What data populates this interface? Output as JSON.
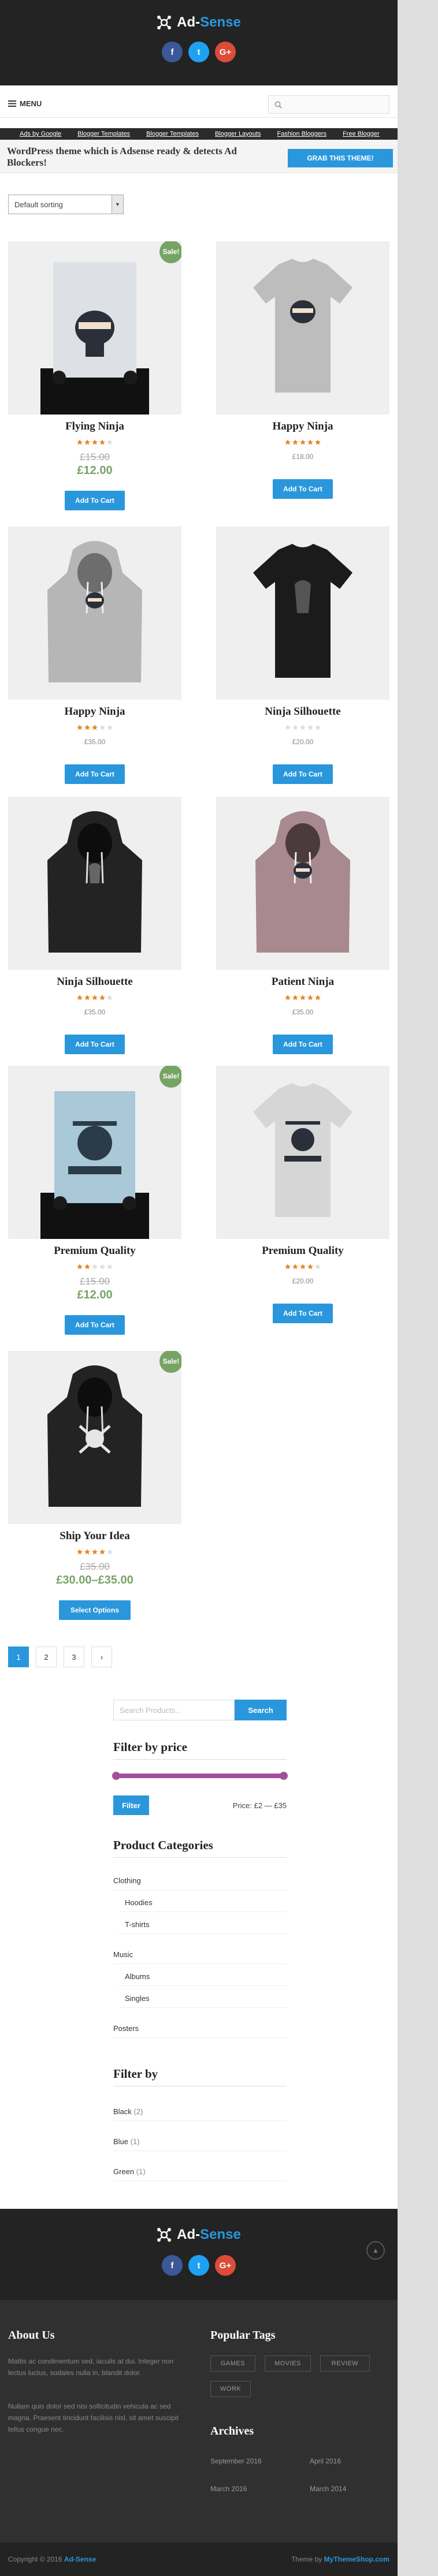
{
  "header": {
    "logo_part1": "Ad-",
    "logo_part2": "Sense",
    "social": [
      {
        "icon": "facebook-icon",
        "glyph": "f"
      },
      {
        "icon": "twitter-icon",
        "glyph": "t"
      },
      {
        "icon": "google-plus-icon",
        "glyph": "G+"
      }
    ]
  },
  "nav": {
    "menu_label": "MENU",
    "search_icon": "search-icon"
  },
  "ticker": [
    "Ads by Google",
    "Blogger Templates",
    "Blogger Templates",
    "Blogger Layouts",
    "Fashion Bloggers",
    "Free Blogger"
  ],
  "promo": {
    "text": "WordPress theme which is Adsense ready & detects Ad Blockers!",
    "button": "GRAB THIS THEME!"
  },
  "sorting": {
    "selected": "Default sorting"
  },
  "products": [
    {
      "title": "Flying Ninja",
      "sale": "Sale!",
      "rating": 4,
      "old_price": "£15.00",
      "price": "£12.00",
      "button": "Add To Cart",
      "image": "poster-ninja"
    },
    {
      "title": "Happy Ninja",
      "rating": 5,
      "price": "£18.00",
      "button": "Add To Cart",
      "image": "tshirt-grey"
    },
    {
      "title": "Happy Ninja",
      "rating": 3,
      "price": "£35.00",
      "button": "Add To Cart",
      "image": "hoodie-grey"
    },
    {
      "title": "Ninja Silhouette",
      "rating": 0,
      "price": "£20.00",
      "button": "Add To Cart",
      "image": "tshirt-black"
    },
    {
      "title": "Ninja Silhouette",
      "rating": 4,
      "price": "£35.00",
      "button": "Add To Cart",
      "image": "hoodie-black"
    },
    {
      "title": "Patient Ninja",
      "rating": 5,
      "price": "£35.00",
      "button": "Add To Cart",
      "image": "hoodie-mauve"
    },
    {
      "title": "Premium Quality",
      "sale": "Sale!",
      "rating": 2,
      "old_price": "£15.00",
      "price": "£12.00",
      "button": "Add To Cart",
      "image": "poster-woo"
    },
    {
      "title": "Premium Quality",
      "rating": 4,
      "price": "£20.00",
      "button": "Add To Cart",
      "image": "tshirt-woo"
    },
    {
      "title": "Ship Your Idea",
      "sale": "Sale!",
      "rating": 4,
      "old_price": "£35.00",
      "price": "£30.00–£35.00",
      "button": "Select Options",
      "image": "hoodie-ship"
    }
  ],
  "pagination": [
    "1",
    "2",
    "3",
    "›"
  ],
  "widgets": {
    "search": {
      "placeholder": "Search Products...",
      "button": "Search"
    },
    "price_filter": {
      "title": "Filter by price",
      "button": "Filter",
      "range": "Price: £2 — £35"
    },
    "categories": {
      "title": "Product Categories",
      "items": [
        {
          "label": "Clothing",
          "level": 0
        },
        {
          "label": "Hoodies",
          "level": 1
        },
        {
          "label": "T-shirts",
          "level": 1
        },
        {
          "label": "Music",
          "level": 0
        },
        {
          "label": "Albums",
          "level": 1
        },
        {
          "label": "Singles",
          "level": 1
        },
        {
          "label": "Posters",
          "level": 0
        }
      ]
    },
    "filter_by": {
      "title": "Filter by",
      "items": [
        {
          "label": "Black",
          "count": "(2)"
        },
        {
          "label": "Blue",
          "count": "(1)"
        },
        {
          "label": "Green",
          "count": "(1)"
        }
      ]
    }
  },
  "footer": {
    "about_title": "About Us",
    "about_p1": "Mattis ac condimentum sed, iaculis at dui. Integer non lectus luctus, sodales nulla in, blandit dolor.",
    "about_p2": "Nullam quis dolor sed nisi sollicitudin vehicula ac sed magna. Praesent tincidunt facilisis nisl, sit amet suscipit tellus congue nec.",
    "tags_title": "Popular Tags",
    "tags": [
      "GAMES",
      "MOVIES",
      "REVIEW",
      "WORK"
    ],
    "archives_title": "Archives",
    "archives": [
      "September 2016",
      "April 2016",
      "March 2016",
      "March 2014"
    ],
    "copyright_prefix": "Copyright © 2016 ",
    "copyright_link": "Ad-Sense",
    "theme_prefix": "Theme by ",
    "theme_link": "MyThemeShop.com",
    "totop_icon": "chevron-up-icon"
  },
  "colors": {
    "accent": "#2a97dc",
    "sale": "#77a464",
    "star": "#e8831f",
    "slider": "#a2509a",
    "header_bg": "#232323"
  }
}
